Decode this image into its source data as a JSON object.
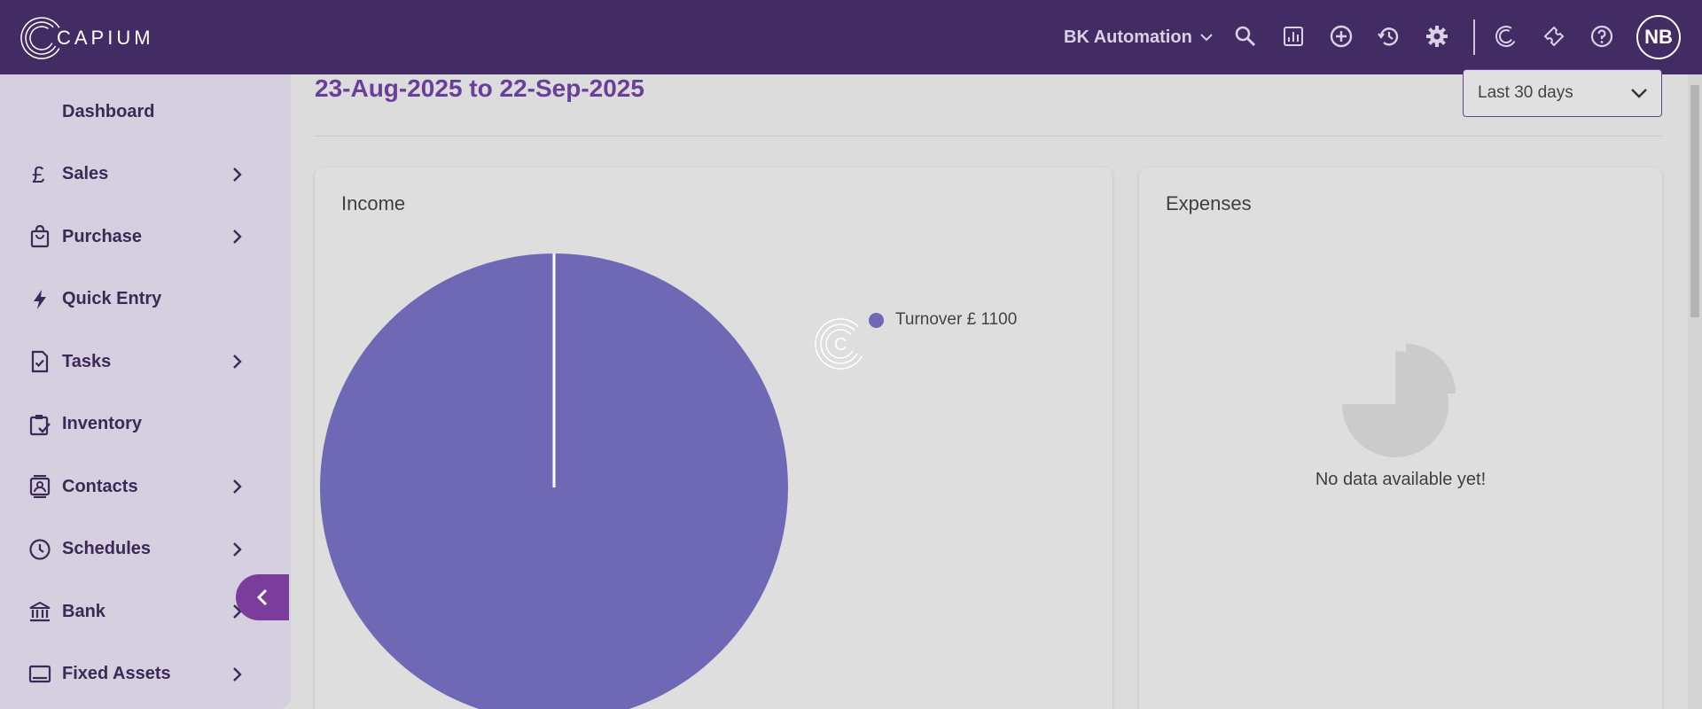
{
  "header": {
    "logo_text": "CAPIUM",
    "org_name": "BK Automation",
    "avatar_initials": "NB",
    "icons": [
      "search-icon",
      "report-icon",
      "add-circle-icon",
      "history-icon",
      "settings-icon",
      "capium-c-icon",
      "ticket-icon",
      "help-icon"
    ]
  },
  "sidebar": {
    "items": [
      {
        "label": "Dashboard",
        "icon": "none",
        "chevron": false
      },
      {
        "label": "Sales",
        "icon": "pound-icon",
        "chevron": true
      },
      {
        "label": "Purchase",
        "icon": "shopping-bag-icon",
        "chevron": true
      },
      {
        "label": "Quick Entry",
        "icon": "lightning-icon",
        "chevron": false
      },
      {
        "label": "Tasks",
        "icon": "task-doc-icon",
        "chevron": true
      },
      {
        "label": "Inventory",
        "icon": "inventory-icon",
        "chevron": false
      },
      {
        "label": "Contacts",
        "icon": "contacts-icon",
        "chevron": true
      },
      {
        "label": "Schedules",
        "icon": "clock-icon",
        "chevron": true
      },
      {
        "label": "Bank",
        "icon": "bank-icon",
        "chevron": true
      },
      {
        "label": "Fixed Assets",
        "icon": "laptop-icon",
        "chevron": true
      }
    ]
  },
  "main": {
    "date_range": "23-Aug-2025 to 22-Sep-2025",
    "period_select": "Last 30 days",
    "income": {
      "title": "Income"
    },
    "expenses": {
      "title": "Expenses",
      "empty_text": "No data available yet!"
    }
  },
  "colors": {
    "header_bg": "#432b63",
    "accent": "#6a3f9b",
    "pie": "#6f69b5"
  },
  "chart_data": {
    "type": "pie",
    "title": "Income",
    "slices": [
      {
        "label": "Turnover",
        "value": 1100,
        "legend_text": "Turnover £ 1100"
      }
    ],
    "legend_placement": "right"
  }
}
